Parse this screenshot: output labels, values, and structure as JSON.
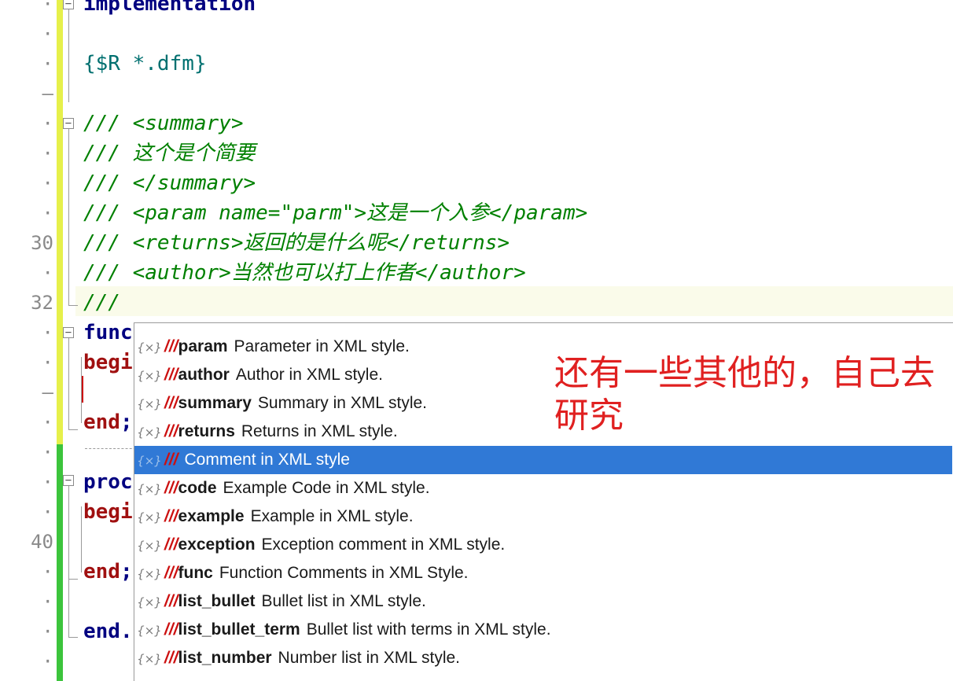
{
  "gutter": {
    "line_30": "30",
    "line_32": "32",
    "line_40": "40",
    "dot": "·",
    "dash": "–"
  },
  "code": {
    "implementation": "implementation",
    "resource_directive": "{$R *.dfm}",
    "doc_lines": [
      "/// <summary>",
      "/// 这个是个简要",
      "/// </summary>",
      "/// <param name=\"parm\">这是一个入参</param>",
      "/// <returns>返回的是什么呢</returns>",
      "/// <author>当然也可以打上作者</author>",
      "///"
    ],
    "func_kw": "func",
    "begin_kw": "begi",
    "end_kw": "end",
    "end_semi": ";",
    "proc_kw": "proc",
    "final_end": "end."
  },
  "completion_popup": {
    "icon": "{×}",
    "items": [
      {
        "prefix": "///",
        "name": "param",
        "desc": "Parameter in XML style."
      },
      {
        "prefix": "///",
        "name": "author",
        "desc": "Author in XML style."
      },
      {
        "prefix": "///",
        "name": "summary",
        "desc": "Summary in XML style."
      },
      {
        "prefix": "///",
        "name": "returns",
        "desc": "Returns in XML style."
      },
      {
        "prefix": "///",
        "name": "",
        "desc": "Comment in XML style"
      },
      {
        "prefix": "///",
        "name": "code",
        "desc": "Example Code in XML style."
      },
      {
        "prefix": "///",
        "name": "example",
        "desc": "Example in XML style."
      },
      {
        "prefix": "///",
        "name": "exception",
        "desc": "Exception comment in XML style."
      },
      {
        "prefix": "///",
        "name": "func",
        "desc": "Function Comments in XML Style."
      },
      {
        "prefix": "///",
        "name": "list_bullet",
        "desc": "Bullet list in XML style."
      },
      {
        "prefix": "///",
        "name": "list_bullet_term",
        "desc": "Bullet list with terms in XML style."
      },
      {
        "prefix": "///",
        "name": "list_number",
        "desc": "Number list in XML style."
      }
    ],
    "selected_index": 4
  },
  "annotation": {
    "text": "还有一些其他的，自己去研究"
  },
  "colors": {
    "keyword": "#000080",
    "keyword_red": "#a01010",
    "comment": "#008000",
    "directive": "#007070",
    "selection": "#3079d6",
    "change_bar": "#e6f04a",
    "change_bar_saved": "#3cc43c",
    "annotation": "#e02020"
  }
}
